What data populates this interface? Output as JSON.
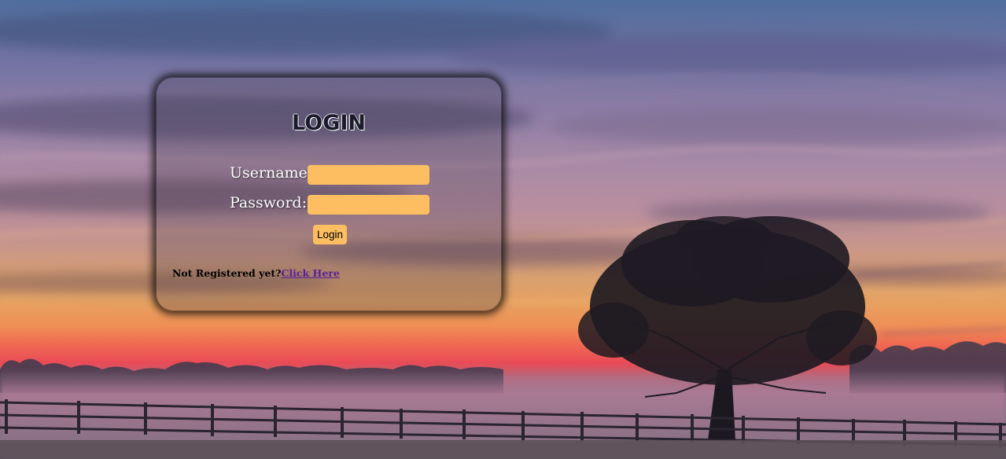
{
  "login_card": {
    "title": "LOGIN",
    "username_label": "Username:",
    "password_label": "Password:",
    "username_value": "",
    "password_value": "",
    "login_button_label": "Login",
    "register_prompt": "Not Registered yet?",
    "register_link_label": "Click Here"
  },
  "colors": {
    "input_fill": "#fdbe62",
    "link": "#5a1f9a",
    "label_text": "#ffffff"
  }
}
